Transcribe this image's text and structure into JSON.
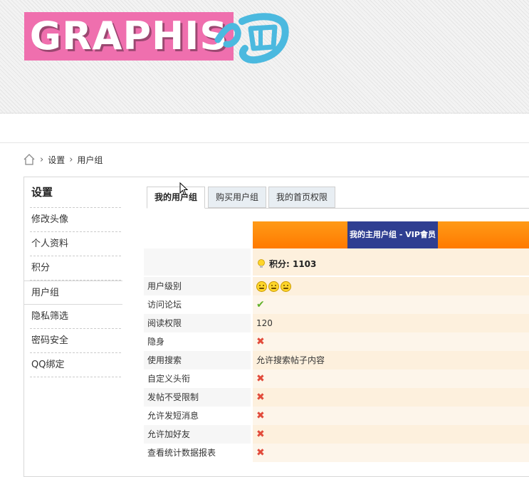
{
  "logo": {
    "text": "GRAPHIS",
    "badge": "吧"
  },
  "breadcrumb": {
    "items": [
      "设置",
      "用户组"
    ]
  },
  "sidebar": {
    "title": "设置",
    "items": [
      {
        "label": "修改头像"
      },
      {
        "label": "个人资料"
      },
      {
        "label": "积分"
      },
      {
        "label": "用户组"
      },
      {
        "label": "隐私筛选"
      },
      {
        "label": "密码安全"
      },
      {
        "label": "QQ绑定"
      }
    ],
    "active": "用户组"
  },
  "tabs": [
    {
      "label": "我的用户组"
    },
    {
      "label": "购买用户组"
    },
    {
      "label": "我的首页权限"
    }
  ],
  "table": {
    "header": "我的主用户组 - VIP會员",
    "points": "积分: 1103",
    "rows": [
      {
        "label": "用户级别",
        "value": "",
        "icon": "smiley-icon"
      },
      {
        "label": "访问论坛",
        "value": "",
        "icon": "check-icon"
      },
      {
        "label": "阅读权限",
        "value": "120",
        "icon": ""
      },
      {
        "label": "隐身",
        "value": "",
        "icon": "cross-icon"
      },
      {
        "label": "使用搜索",
        "value": "允许搜索帖子内容",
        "icon": ""
      },
      {
        "label": "自定义头衔",
        "value": "",
        "icon": "cross-icon"
      },
      {
        "label": "发帖不受限制",
        "value": "",
        "icon": "cross-icon"
      },
      {
        "label": "允许发短消息",
        "value": "",
        "icon": "cross-icon"
      },
      {
        "label": "允许加好友",
        "value": "",
        "icon": "cross-icon"
      },
      {
        "label": "查看统计数据报表",
        "value": "",
        "icon": "cross-icon"
      }
    ]
  },
  "colors": {
    "logo_bg": "#ef6fae",
    "header_orange": "#ff8a0a",
    "header_label_bg": "#2f3e91",
    "row_bg": "#fdf0dd",
    "cross": "#e24b3b",
    "check": "#62b12a"
  }
}
